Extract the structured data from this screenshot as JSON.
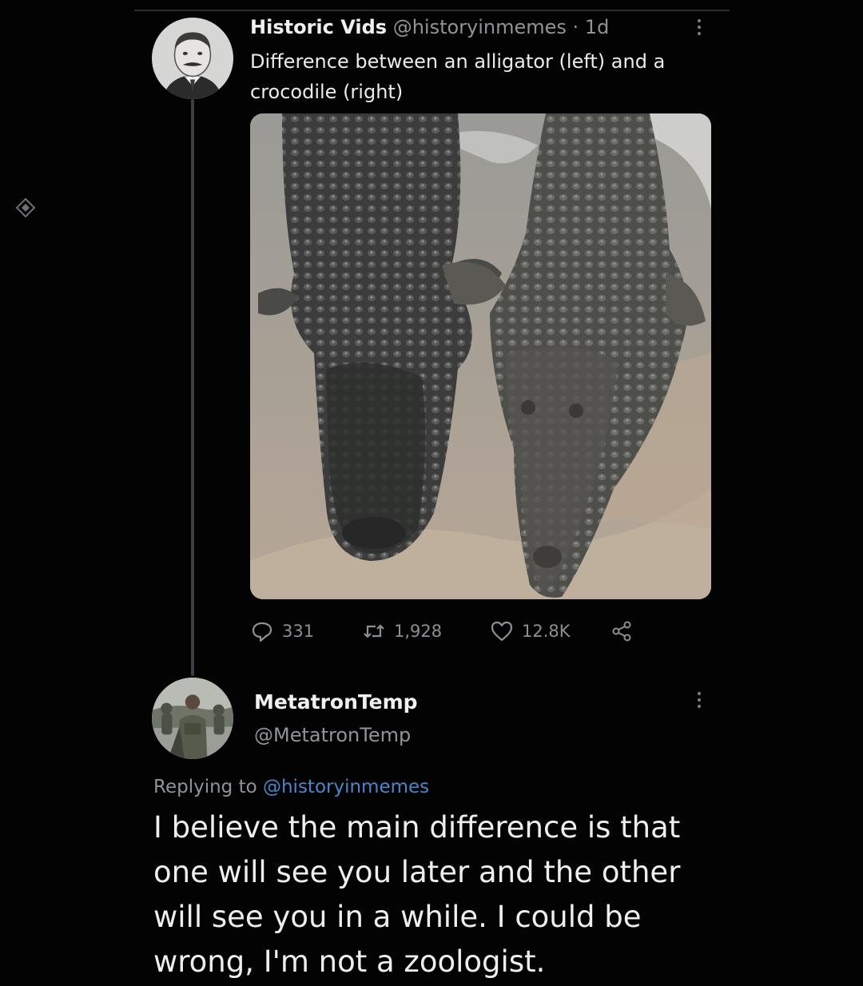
{
  "tweet": {
    "display_name": "Historic Vids",
    "handle": "@historyinmemes",
    "separator": "·",
    "time": "1d",
    "text": "Difference between an alligator (left) and a crocodile (right)",
    "avatar_icon": "portrait-avatar",
    "media": "alligator-and-crocodile-photo",
    "actions": {
      "replies": "331",
      "retweets": "1,928",
      "likes": "12.8K"
    }
  },
  "reply": {
    "display_name": "MetatronTemp",
    "handle": "@MetatronTemp",
    "replying_prefix": "Replying to",
    "replying_to": "@historyinmemes",
    "text": "I believe the main difference is that one will see you later and the other will see you in a while. I could be wrong, I'm not a zoologist.",
    "avatar_icon": "soldier-avatar"
  },
  "icons": [
    "reply-icon",
    "retweet-icon",
    "like-icon",
    "share-icon",
    "more-icon",
    "diamond-icon"
  ],
  "colors": {
    "background": "#030303",
    "text": "#e7e9ea",
    "muted": "#8f9499",
    "link": "#4a86c9",
    "thread_line": "#3c3f43"
  }
}
